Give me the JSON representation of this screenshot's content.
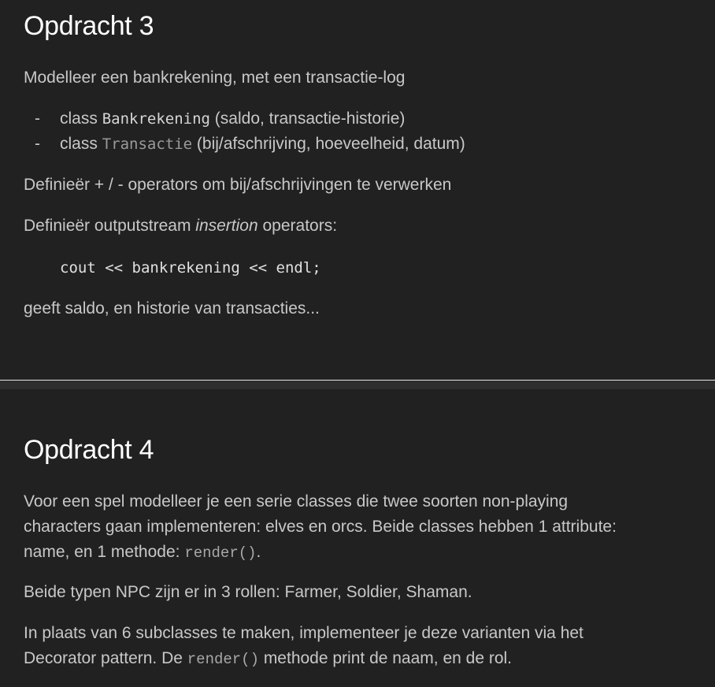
{
  "slide3": {
    "title": "Opdracht 3",
    "intro": "Modelleer een bankrekening, met een transactie-log",
    "bullets": [
      {
        "dash": "-",
        "prefix": "class ",
        "code": "Bankrekening",
        "suffix": " (saldo, transactie-historie)"
      },
      {
        "dash": "-",
        "prefix": "class ",
        "code": "Transactie",
        "suffix": " (bij/afschrijving, hoeveelheid, datum)"
      }
    ],
    "operators_line": "Definieër + / - operators om bij/afschrijvingen te verwerken",
    "insertion_prefix": "Definieër outputstream ",
    "insertion_italic": "insertion",
    "insertion_suffix": " operators:",
    "code_example": "cout << bankrekening << endl;",
    "result_line": "geeft saldo, en historie van transacties..."
  },
  "slide4": {
    "title": "Opdracht 4",
    "para1_line1": "Voor een spel modelleer je een serie classes die twee soorten non-playing",
    "para1_line2": "characters gaan implementeren: elves en orcs. Beide classes hebben 1 attribute:",
    "para1_line3_prefix": "name, en 1 methode: ",
    "para1_line3_code": "render()",
    "para1_line3_suffix": ".",
    "para2": "Beide typen NPC zijn er in 3 rollen: Farmer, Soldier, Shaman.",
    "para3_line1": "In plaats van 6 subclasses te maken, implementeer je deze varianten via het",
    "para3_line2_prefix": "Decorator pattern. De ",
    "para3_line2_code": "render()",
    "para3_line2_suffix": " methode print de naam, en de rol."
  }
}
